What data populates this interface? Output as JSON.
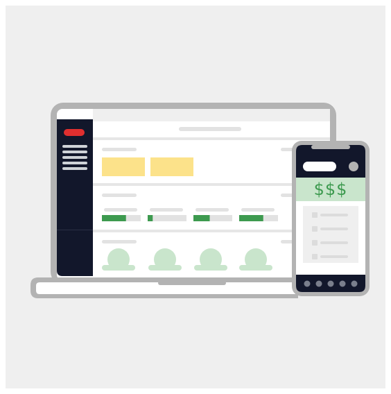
{
  "phone": {
    "price_text": "$$$"
  },
  "colors": {
    "background": "#efefef",
    "device_frame": "#b3b3b3",
    "sidebar": "#12172b",
    "accent_red": "#e02f2f",
    "placeholder_line": "#e2e2e2",
    "yellow_card": "#fce28a",
    "progress_green": "#3d9a4f",
    "light_green": "#c9e5cc"
  },
  "dashboard": {
    "progress_bars": [
      0.62,
      0.13,
      0.42,
      0.62
    ]
  }
}
